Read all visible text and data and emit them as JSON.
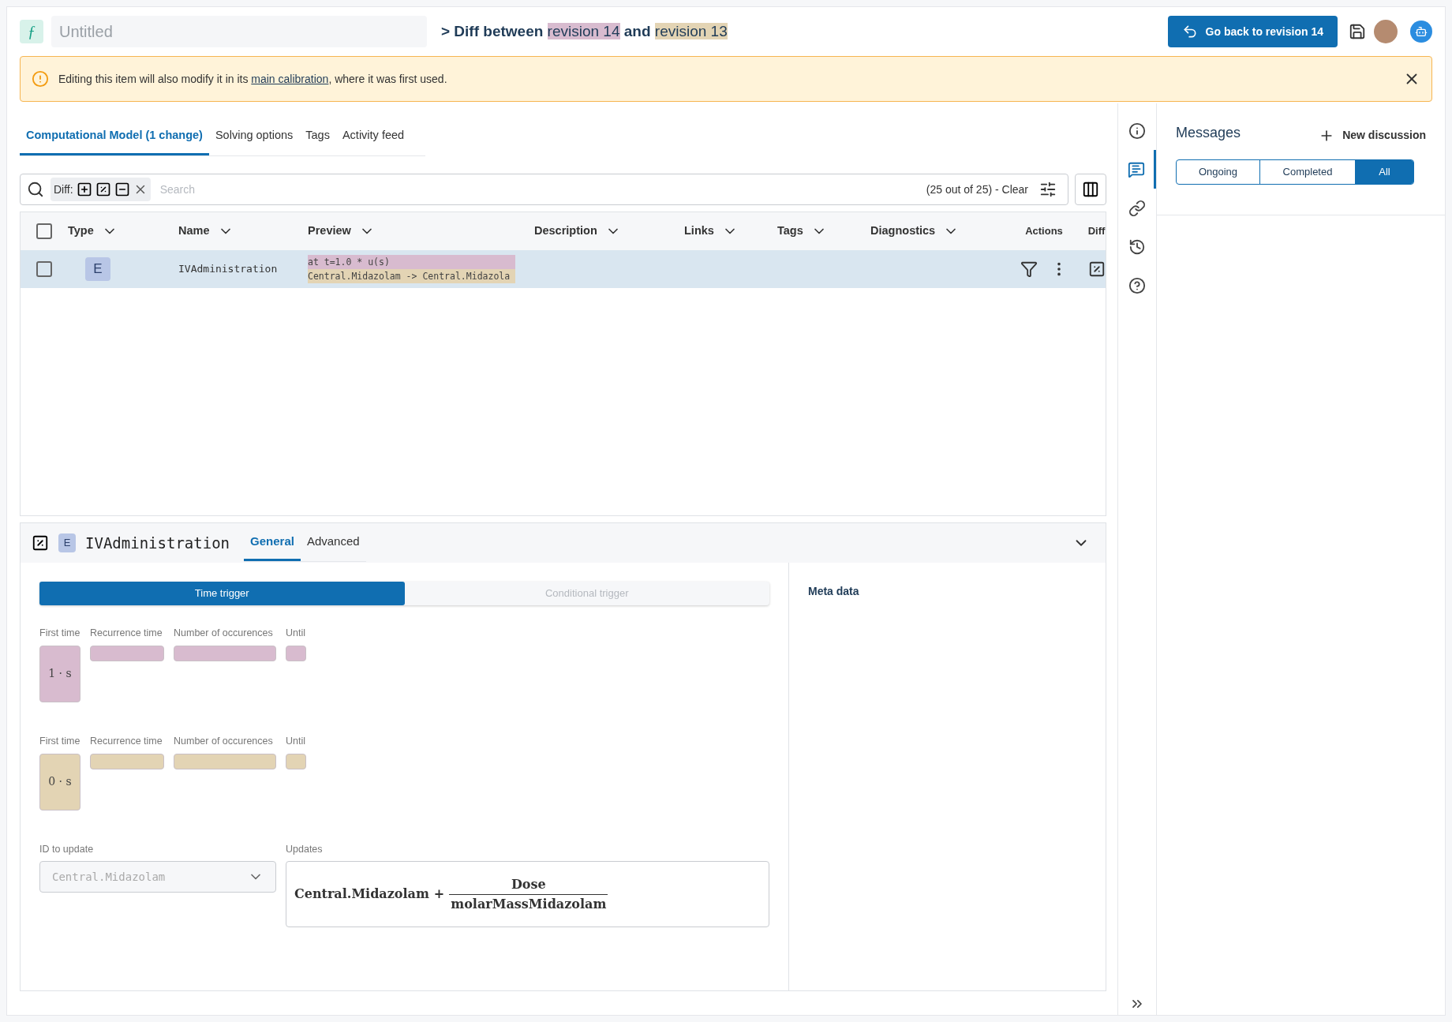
{
  "header": {
    "logo": "ƒ",
    "title_placeholder": "Untitled",
    "diff_prefix": "> Diff between",
    "rev_a": "revision 14",
    "diff_and": "and",
    "rev_b": "revision 13",
    "back_button": "Go back to revision 14"
  },
  "banner": {
    "before": "Editing this item will also modify it in its",
    "link": "main calibration",
    "after": ", where it was first used."
  },
  "tabs": [
    {
      "label": "Computational Model (1 change)",
      "selected": true
    },
    {
      "label": "Solving options",
      "selected": false
    },
    {
      "label": "Tags",
      "selected": false
    },
    {
      "label": "Activity feed",
      "selected": false
    }
  ],
  "search": {
    "diff_label": "Diff:",
    "placeholder": "Search",
    "count": "(25 out of 25) - Clear"
  },
  "table": {
    "all_checked": false,
    "columns": [
      {
        "label": "Type",
        "kind": "sortable"
      },
      {
        "label": "Name",
        "kind": "sortable"
      },
      {
        "label": "Preview",
        "kind": "sortable"
      },
      {
        "label": "Description",
        "kind": "sortable"
      },
      {
        "label": "Links",
        "kind": "sortable"
      },
      {
        "label": "Tags",
        "kind": "sortable"
      },
      {
        "label": "Diagnostics",
        "kind": "sortable"
      },
      {
        "label": "Actions",
        "kind": "plain"
      },
      {
        "label": "Diff",
        "kind": "plain"
      }
    ],
    "rows": [
      {
        "checked": false,
        "selected": true,
        "type": "E",
        "name": "IVAdministration",
        "preview": [
          {
            "text": "at t=1.0 * u(s)",
            "kind": "old"
          },
          {
            "text": "Central.Midazolam -> Central.Midazola",
            "kind": "new"
          }
        ]
      }
    ]
  },
  "detail": {
    "type": "E",
    "name": "IVAdministration",
    "tabs": [
      {
        "label": "General",
        "selected": true
      },
      {
        "label": "Advanced",
        "selected": false
      }
    ],
    "triggers": [
      {
        "label": "Time trigger",
        "selected": true
      },
      {
        "label": "Conditional trigger",
        "selected": false
      }
    ],
    "schedules": [
      {
        "kind": "old",
        "fields": [
          {
            "label": "First time",
            "value": "1 · s"
          },
          {
            "label": "Recurrence time"
          },
          {
            "label": "Number of occurences"
          },
          {
            "label": "Until"
          }
        ]
      },
      {
        "kind": "new",
        "fields": [
          {
            "label": "First time",
            "value": "0 · s"
          },
          {
            "label": "Recurrence time"
          },
          {
            "label": "Number of occurences"
          },
          {
            "label": "Until"
          }
        ]
      }
    ],
    "id_label": "ID to update",
    "id_value": "Central.Midazolam",
    "updates_label": "Updates",
    "formula": {
      "term": "Central.Midazolam",
      "op": "+",
      "numerator": "Dose",
      "denominator": "molarMassMidazolam"
    },
    "meta_title": "Meta data"
  },
  "rail": [
    {
      "selected": false
    },
    {
      "selected": true
    },
    {
      "selected": false
    },
    {
      "selected": false
    },
    {
      "selected": false
    }
  ],
  "messages": {
    "title": "Messages",
    "new_button": "New discussion",
    "filters": [
      {
        "label": "Ongoing",
        "selected": false
      },
      {
        "label": "Completed",
        "selected": false
      },
      {
        "label": "All",
        "selected": true
      }
    ]
  }
}
